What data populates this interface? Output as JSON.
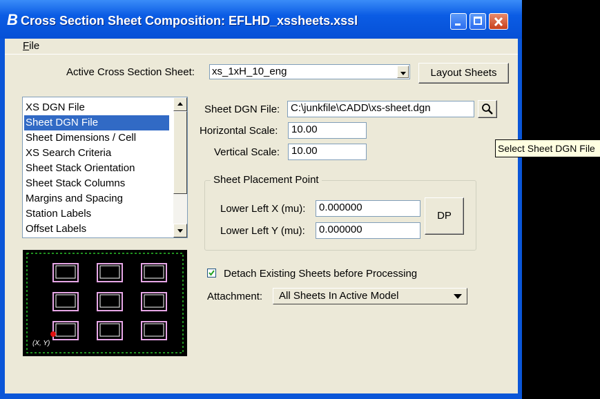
{
  "window": {
    "title": "Cross Section Sheet Composition: EFLHD_xssheets.xssl",
    "app_icon": "bentley-b-icon"
  },
  "menu": {
    "file_label_underlined": "F",
    "file_label_rest": "ile"
  },
  "active_sheet": {
    "label": "Active Cross Section Sheet:",
    "value": "xs_1xH_10_eng",
    "layout_button": "Layout Sheets"
  },
  "category_list": {
    "items": [
      {
        "label": "XS DGN File",
        "selected": false
      },
      {
        "label": "Sheet DGN File",
        "selected": true
      },
      {
        "label": "Sheet Dimensions / Cell",
        "selected": false
      },
      {
        "label": "XS Search Criteria",
        "selected": false
      },
      {
        "label": "Sheet Stack Orientation",
        "selected": false
      },
      {
        "label": "Sheet Stack Columns",
        "selected": false
      },
      {
        "label": "Margins and Spacing",
        "selected": false
      },
      {
        "label": "Station Labels",
        "selected": false
      },
      {
        "label": "Offset Labels",
        "selected": false
      }
    ]
  },
  "sheet_dgn": {
    "file_label": "Sheet DGN File:",
    "file_value": "C:\\junkfile\\CADD\\xs-sheet.dgn",
    "browse_icon": "magnifier-icon",
    "h_scale_label": "Horizontal Scale:",
    "h_scale_value": "10.00",
    "v_scale_label": "Vertical Scale:",
    "v_scale_value": "10.00"
  },
  "placement": {
    "group_title": "Sheet Placement Point",
    "x_label": "Lower Left X (mu):",
    "x_value": "0.000000",
    "y_label": "Lower Left Y (mu):",
    "y_value": "0.000000",
    "dp_button": "DP"
  },
  "detach": {
    "checked": true,
    "label": "Detach Existing Sheets before Processing"
  },
  "attachment": {
    "label": "Attachment:",
    "value": "All Sheets In Active Model"
  },
  "preview": {
    "origin_label": "(X, Y)"
  },
  "tooltip": {
    "text": "Select Sheet DGN File"
  },
  "colors": {
    "titlebar": "#0b5ce4",
    "selection": "#316ac5",
    "sheet_outline": "#e8a8e8",
    "border_dash": "#2bc42b",
    "origin_dot": "#e01010"
  }
}
